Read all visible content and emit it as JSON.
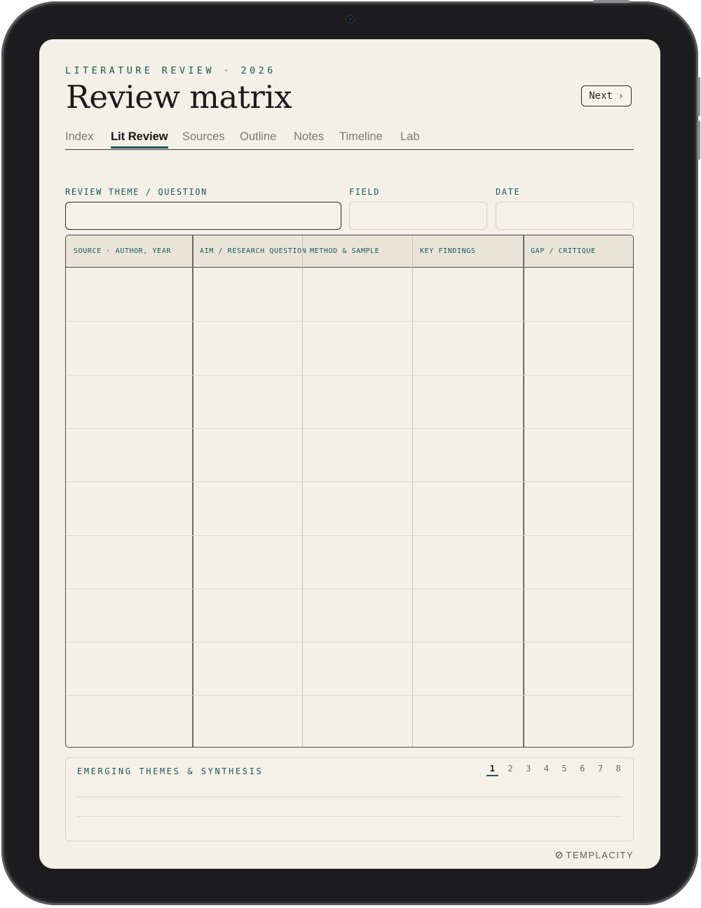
{
  "header": {
    "eyebrow": "LITERATURE REVIEW · 2026",
    "title": "Review matrix",
    "next_label": "Next",
    "next_icon": "chevron-right-icon"
  },
  "tabs": [
    {
      "label": "Index",
      "active": false
    },
    {
      "label": "Lit Review",
      "active": true
    },
    {
      "label": "Sources",
      "active": false
    },
    {
      "label": "Outline",
      "active": false
    },
    {
      "label": "Notes",
      "active": false
    },
    {
      "label": "Timeline",
      "active": false
    },
    {
      "label": "Lab",
      "active": false
    }
  ],
  "fields": {
    "theme": {
      "label": "REVIEW THEME / QUESTION",
      "value": ""
    },
    "field": {
      "label": "FIELD",
      "value": ""
    },
    "date": {
      "label": "DATE",
      "value": ""
    }
  },
  "matrix": {
    "columns": [
      "SOURCE · AUTHOR, YEAR",
      "AIM / RESEARCH QUESTION",
      "METHOD & SAMPLE",
      "KEY FINDINGS",
      "GAP / CRITIQUE"
    ],
    "rows": [
      [
        "",
        "",
        "",
        "",
        ""
      ],
      [
        "",
        "",
        "",
        "",
        ""
      ],
      [
        "",
        "",
        "",
        "",
        ""
      ],
      [
        "",
        "",
        "",
        "",
        ""
      ],
      [
        "",
        "",
        "",
        "",
        ""
      ],
      [
        "",
        "",
        "",
        "",
        ""
      ],
      [
        "",
        "",
        "",
        "",
        ""
      ],
      [
        "",
        "",
        "",
        "",
        ""
      ],
      [
        "",
        "",
        "",
        "",
        ""
      ]
    ]
  },
  "synthesis": {
    "label": "EMERGING THEMES & SYNTHESIS",
    "pages": [
      "1",
      "2",
      "3",
      "4",
      "5",
      "6",
      "7",
      "8"
    ],
    "current_page": "1"
  },
  "brand": {
    "name": "TEMPLACITY",
    "icon": "templacity-logo-icon"
  },
  "colors": {
    "accent": "#1f5653",
    "paper": "#f3f0e7",
    "header_fill": "#e8e4d8",
    "frame": "#1c1c1e"
  }
}
